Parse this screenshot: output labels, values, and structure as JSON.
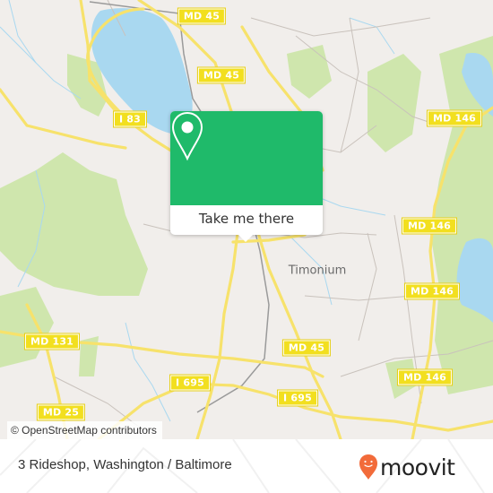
{
  "map": {
    "colors": {
      "land": "#f1eeeb",
      "water": "#a9d8f0",
      "park": "#cfe6ad",
      "motorway": "#f7e26b",
      "shield": "#f2df1f",
      "accent": "#1fba6a",
      "brand": "#f26b3a"
    },
    "road_labels": [
      "MD 45",
      "MD 45",
      "I 83",
      "MD 146",
      "MD 146",
      "MD 146",
      "MD 146",
      "MD 45",
      "MD 131",
      "MD 25",
      "I 695",
      "I 695"
    ],
    "place_labels": [
      "Timonium"
    ],
    "attribution": "© OpenStreetMap contributors"
  },
  "popup": {
    "icon": "map-pin-icon",
    "cta_label": "Take me there"
  },
  "footer": {
    "title": "3 Rideshop, Washington / Baltimore",
    "logo_icon": "moovit-smile-pin-icon",
    "logo_text": "moovit"
  }
}
